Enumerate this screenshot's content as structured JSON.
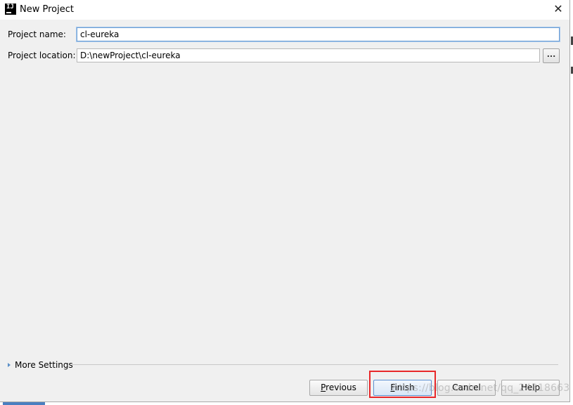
{
  "window": {
    "title": "New Project",
    "app_icon_text": "IJ",
    "app_icon": "intellij-icon",
    "close_glyph": "✕",
    "close_icon": "close-icon"
  },
  "form": {
    "name_label": "Project name:",
    "name_value": "cl-eureka",
    "location_label": "Project location:",
    "location_value": "D:\\newProject\\cl-eureka",
    "browse_label": "..."
  },
  "more_settings": {
    "label": "More Settings",
    "icon": "expand-arrow-icon",
    "accent": "#5a8fc8"
  },
  "buttons": {
    "previous": {
      "mnemonic": "P",
      "rest": "revious"
    },
    "finish": {
      "mnemonic": "F",
      "rest": "inish"
    },
    "cancel": {
      "label": "Cancel"
    },
    "help": {
      "label": "Help"
    }
  },
  "annotation": {
    "color": "#e8282a"
  },
  "watermark": {
    "text": "https://blog.csdn.net/qq_24318663"
  }
}
